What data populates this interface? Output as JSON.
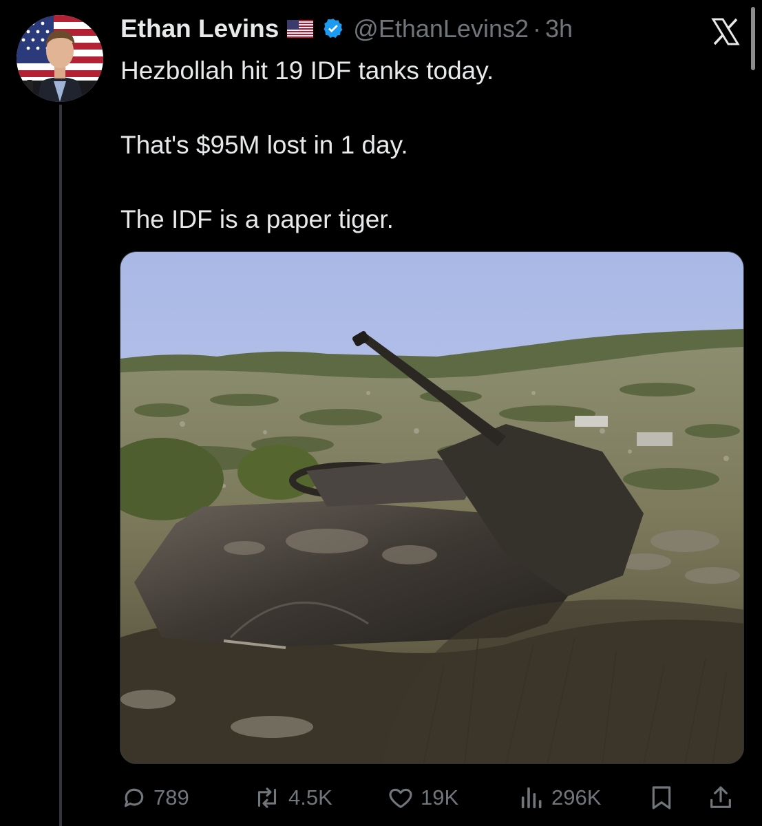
{
  "author": {
    "display_name": "Ethan Levins",
    "handle": "@EthanLevins2",
    "separator": "·",
    "time_ago": "3h",
    "flag": "us-flag",
    "verified_badge": "verified-icon"
  },
  "tweet": {
    "lines": [
      "Hezbollah hit 19 IDF tanks today.",
      "That's $95M lost in 1 day.",
      "The IDF is a paper tiger."
    ]
  },
  "media": {
    "subject": "destroyed-tank-photo",
    "colors": {
      "sky": "#b8c6e8",
      "hills": "#8f8a6d",
      "vegetation": "#5f6b3e",
      "tank": "#3b3631"
    }
  },
  "actions": {
    "reply": {
      "icon": "reply-icon",
      "count": "789"
    },
    "repost": {
      "icon": "repost-icon",
      "count": "4.5K"
    },
    "like": {
      "icon": "heart-icon",
      "count": "19K"
    },
    "views": {
      "icon": "views-icon",
      "count": "296K"
    },
    "bookmark": {
      "icon": "bookmark-icon"
    },
    "share": {
      "icon": "share-icon"
    }
  },
  "brand": {
    "logo": "x-logo-icon",
    "text_color": "#e7e9ea",
    "muted_color": "#71767b",
    "verified_color": "#1d9bf0"
  }
}
